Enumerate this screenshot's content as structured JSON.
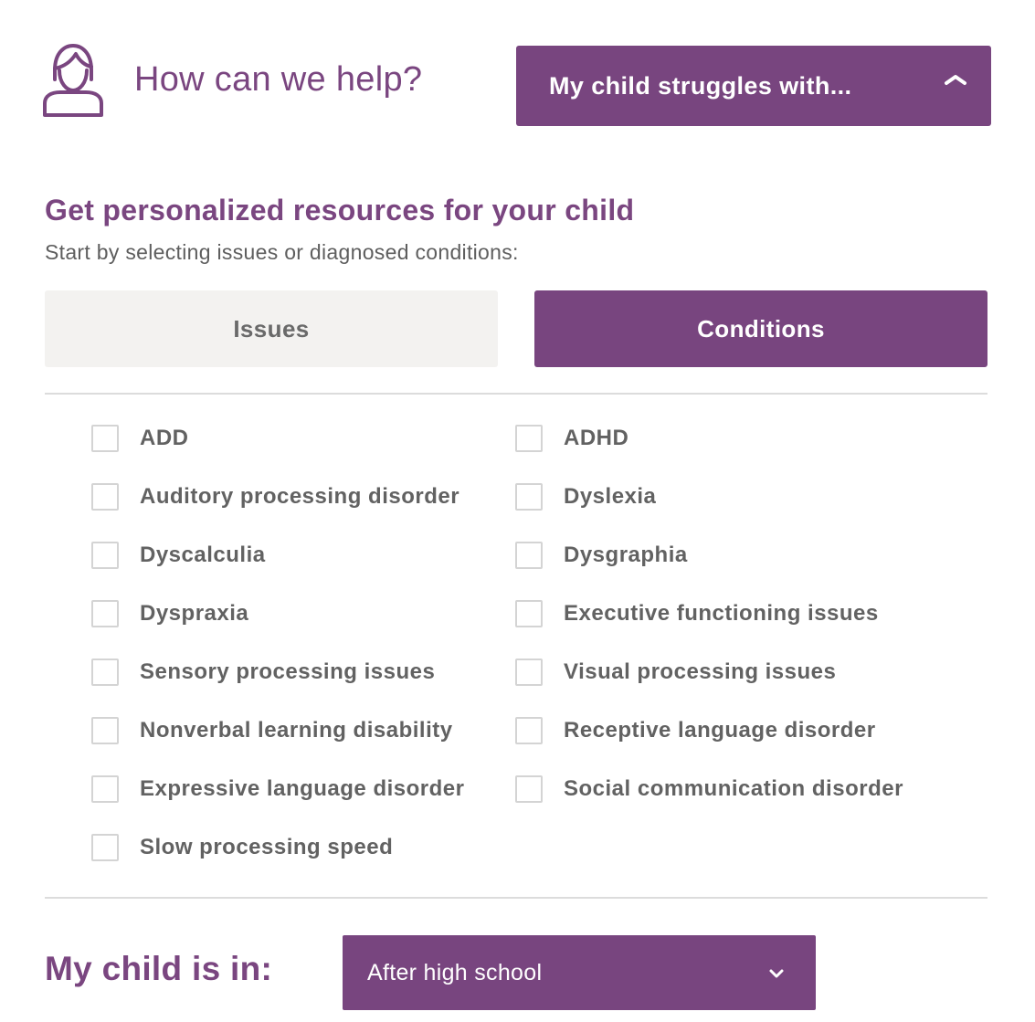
{
  "header": {
    "icon": "user-icon",
    "title": "How can we help?",
    "dropdown_label": "My child struggles with...",
    "dropdown_icon": "chevron-up-icon"
  },
  "section": {
    "title": "Get personalized resources for your child",
    "subtitle": "Start by selecting issues or diagnosed conditions:"
  },
  "tabs": [
    {
      "label": "Issues",
      "active": false
    },
    {
      "label": "Conditions",
      "active": true
    }
  ],
  "conditions": [
    {
      "label": "ADD",
      "checked": false
    },
    {
      "label": "ADHD",
      "checked": false
    },
    {
      "label": "Auditory processing disorder",
      "checked": false
    },
    {
      "label": "Dyslexia",
      "checked": false
    },
    {
      "label": "Dyscalculia",
      "checked": false
    },
    {
      "label": "Dysgraphia",
      "checked": false
    },
    {
      "label": "Dyspraxia",
      "checked": false
    },
    {
      "label": "Executive functioning issues",
      "checked": false
    },
    {
      "label": "Sensory processing issues",
      "checked": false
    },
    {
      "label": "Visual processing issues",
      "checked": false
    },
    {
      "label": "Nonverbal learning disability",
      "checked": false
    },
    {
      "label": "Receptive language disorder",
      "checked": false
    },
    {
      "label": "Expressive language disorder",
      "checked": false
    },
    {
      "label": "Social communication disorder",
      "checked": false
    },
    {
      "label": "Slow processing speed",
      "checked": false
    }
  ],
  "grade": {
    "label": "My child is in:",
    "selected": "After high school",
    "icon": "chevron-down-icon"
  },
  "colors": {
    "accent": "#78457f",
    "accent_text": "#7a4680",
    "tab_inactive_bg": "#f3f2f0",
    "body_text": "#626262"
  }
}
